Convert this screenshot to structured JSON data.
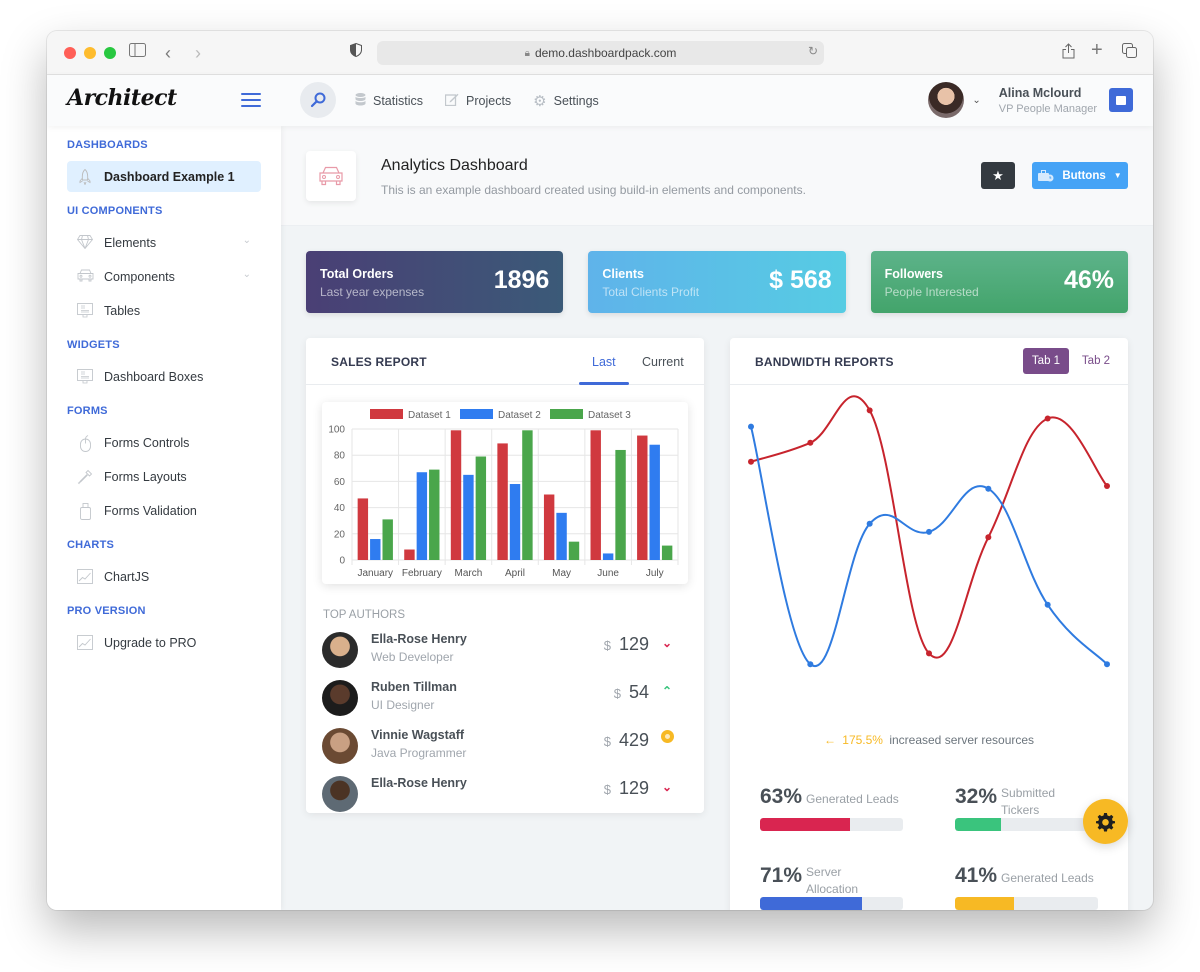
{
  "browser": {
    "url": "demo.dashboardpack.com",
    "traffic_lights": [
      "#ff5f57",
      "#febc2e",
      "#28c840"
    ]
  },
  "header": {
    "logo": "Architect",
    "nav": [
      {
        "label": "Statistics",
        "icon": "database-icon"
      },
      {
        "label": "Projects",
        "icon": "edit-icon"
      },
      {
        "label": "Settings",
        "icon": "gear-icon"
      }
    ],
    "user": {
      "name": "Alina Mclourd",
      "role": "VP People Manager"
    }
  },
  "sidebar": {
    "sections": [
      {
        "heading": "Dashboards",
        "items": [
          {
            "label": "Dashboard Example 1",
            "icon": "rocket-icon",
            "active": true
          }
        ]
      },
      {
        "heading": "UI Components",
        "items": [
          {
            "label": "Elements",
            "icon": "diamond-icon",
            "expandable": true
          },
          {
            "label": "Components",
            "icon": "car-icon",
            "expandable": true
          },
          {
            "label": "Tables",
            "icon": "display-icon"
          }
        ]
      },
      {
        "heading": "Widgets",
        "items": [
          {
            "label": "Dashboard Boxes",
            "icon": "display-icon"
          }
        ]
      },
      {
        "heading": "Forms",
        "items": [
          {
            "label": "Forms Controls",
            "icon": "mouse-icon"
          },
          {
            "label": "Forms Layouts",
            "icon": "eyedropper-icon"
          },
          {
            "label": "Forms Validation",
            "icon": "usb-icon"
          }
        ]
      },
      {
        "heading": "Charts",
        "items": [
          {
            "label": "ChartJS",
            "icon": "graph-icon"
          }
        ]
      },
      {
        "heading": "PRO Version",
        "items": [
          {
            "label": "Upgrade to PRO",
            "icon": "graph-icon"
          }
        ]
      }
    ]
  },
  "page": {
    "title": "Analytics Dashboard",
    "subtitle": "This is an example dashboard created using build-in elements and components.",
    "buttons_label": "Buttons"
  },
  "stats": [
    {
      "title": "Total Orders",
      "subtitle": "Last year expenses",
      "value": "1896",
      "gradient": [
        "#4a3f75",
        "#3b5a78"
      ]
    },
    {
      "title": "Clients",
      "subtitle": "Total Clients Profit",
      "value": "$ 568",
      "gradient": [
        "#5fb3ea",
        "#56cce3"
      ]
    },
    {
      "title": "Followers",
      "subtitle": "People Interested",
      "value": "46%",
      "gradient": [
        "#5db38a",
        "#43a46b"
      ]
    }
  ],
  "sales_report": {
    "title": "Sales Report",
    "tabs": [
      {
        "label": "Last",
        "active": true
      },
      {
        "label": "Current",
        "active": false
      }
    ],
    "authors_heading": "Top Authors",
    "authors": [
      {
        "name": "Ella-Rose Henry",
        "job": "Web Developer",
        "currency": "$",
        "amount": "129",
        "trend": "down"
      },
      {
        "name": "Ruben Tillman",
        "job": "UI Designer",
        "currency": "$",
        "amount": "54",
        "trend": "up"
      },
      {
        "name": "Vinnie Wagstaff",
        "job": "Java Programmer",
        "currency": "$",
        "amount": "429",
        "trend": "neutral"
      },
      {
        "name": "Ella-Rose Henry",
        "job": "",
        "currency": "$",
        "amount": "129",
        "trend": "down"
      }
    ]
  },
  "bandwidth": {
    "title": "Bandwidth Reports",
    "tabs": [
      {
        "label": "Tab 1",
        "active": true
      },
      {
        "label": "Tab 2",
        "active": false
      }
    ],
    "change": "175.5%",
    "change_text": "increased server resources",
    "progress": [
      {
        "value": "63%",
        "label": "Generated Leads",
        "percent": 63,
        "color": "#d92550"
      },
      {
        "value": "32%",
        "label": "Submitted Tickers",
        "percent": 32,
        "color": "#3ac47d"
      },
      {
        "value": "71%",
        "label": "Server Allocation",
        "percent": 71,
        "color": "#3f6ad8"
      },
      {
        "value": "41%",
        "label": "Generated Leads",
        "percent": 41,
        "color": "#f7b924"
      }
    ]
  },
  "chart_data": [
    {
      "type": "bar",
      "title": "",
      "categories": [
        "January",
        "February",
        "March",
        "April",
        "May",
        "June",
        "July"
      ],
      "series": [
        {
          "name": "Dataset 1",
          "color": "#d0393f",
          "values": [
            47,
            8,
            99,
            89,
            50,
            99,
            95
          ]
        },
        {
          "name": "Dataset 2",
          "color": "#2f7cf0",
          "values": [
            16,
            67,
            65,
            58,
            36,
            5,
            88
          ]
        },
        {
          "name": "Dataset 3",
          "color": "#4aa64b",
          "values": [
            31,
            69,
            79,
            99,
            14,
            84,
            11
          ]
        }
      ],
      "ylim": [
        0,
        100
      ],
      "yticks": [
        0,
        20,
        40,
        60,
        80,
        100
      ],
      "grid": true,
      "legend": "top"
    },
    {
      "type": "line",
      "title": "",
      "x": [
        1,
        2,
        3,
        4,
        5,
        6,
        7
      ],
      "series": [
        {
          "name": "red",
          "color": "#c7242d",
          "values": [
            79,
            86,
            98,
            8,
            51,
            95,
            70
          ]
        },
        {
          "name": "blue",
          "color": "#2f7be0",
          "values": [
            92,
            4,
            56,
            53,
            69,
            26,
            4
          ]
        }
      ],
      "ylim": [
        0,
        100
      ],
      "grid": false,
      "legend": "none"
    }
  ]
}
